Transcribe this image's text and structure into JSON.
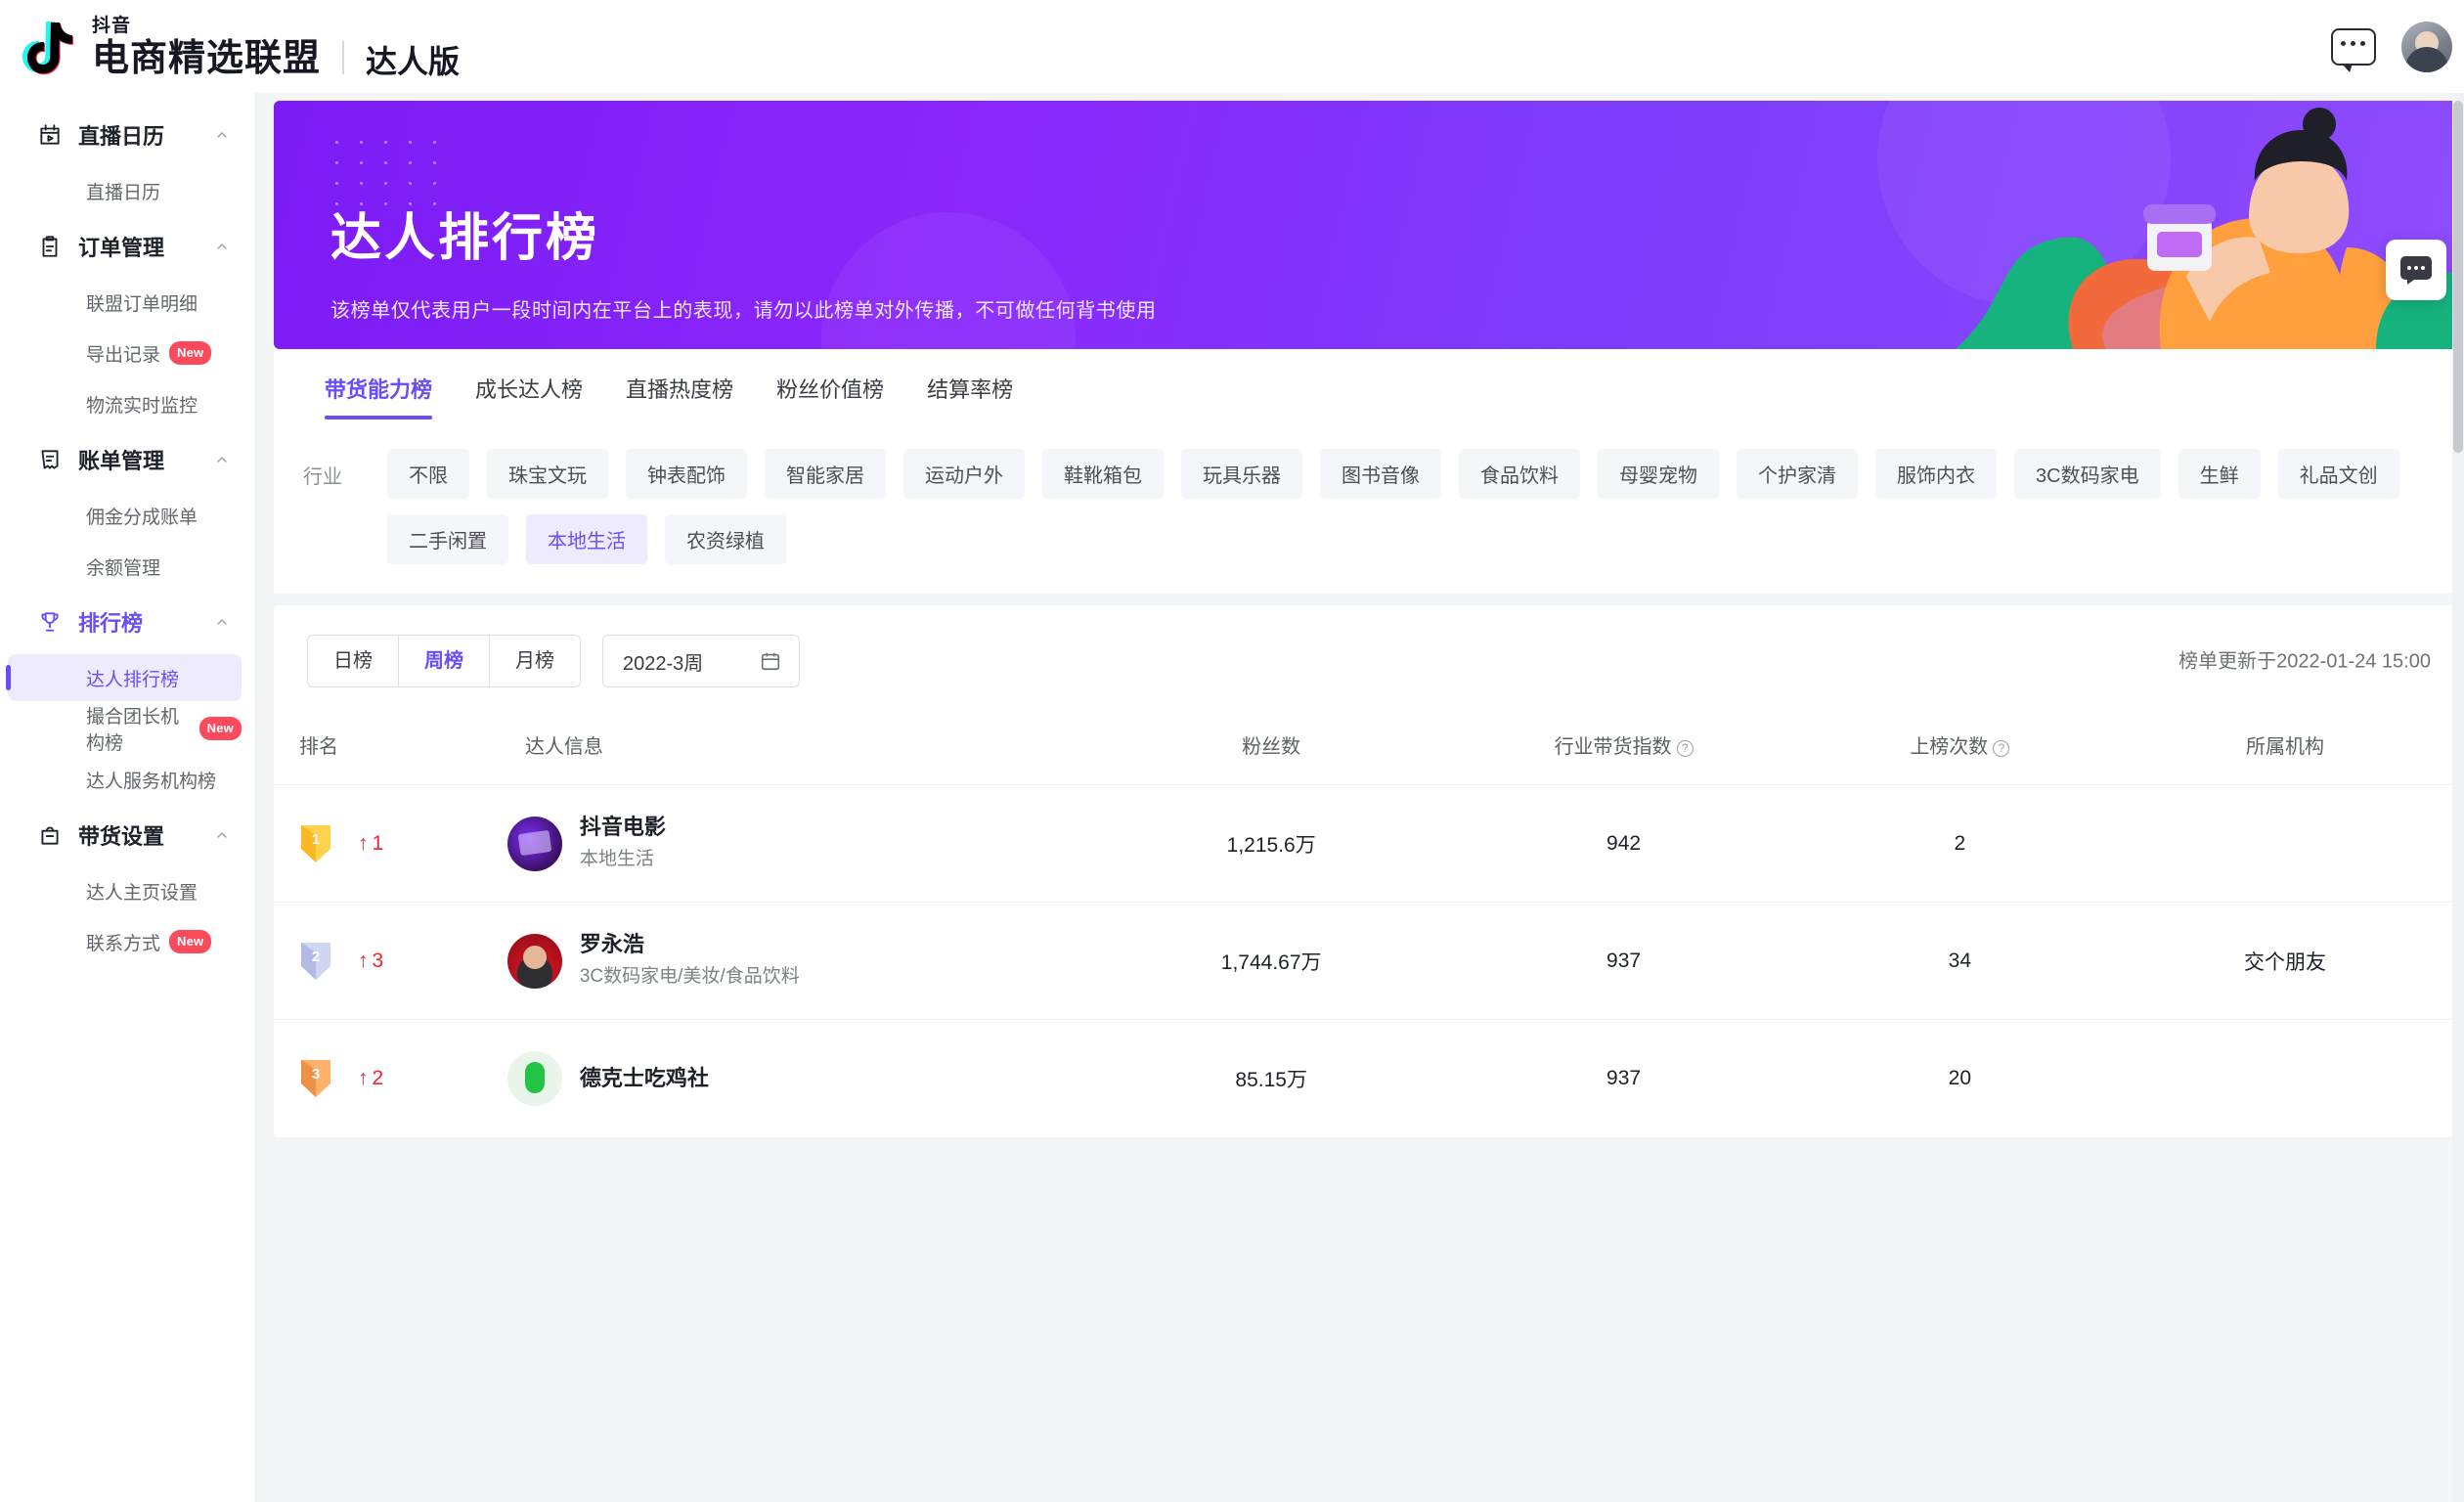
{
  "header": {
    "logo_sup": "抖音",
    "brand_main": "电商精选联盟",
    "brand_sub": "达人版",
    "chat_icon": "chat-bubble-icon",
    "avatar": "user-avatar"
  },
  "sidebar": {
    "groups": [
      {
        "icon": "calendar-play-icon",
        "label": "直播日历",
        "chevron": "chevron-up-icon",
        "active": false,
        "items": [
          {
            "label": "直播日历",
            "badge": "",
            "selected": false
          }
        ]
      },
      {
        "icon": "clipboard-icon",
        "label": "订单管理",
        "chevron": "chevron-up-icon",
        "active": false,
        "items": [
          {
            "label": "联盟订单明细",
            "badge": "",
            "selected": false
          },
          {
            "label": "导出记录",
            "badge": "New",
            "selected": false
          },
          {
            "label": "物流实时监控",
            "badge": "",
            "selected": false
          }
        ]
      },
      {
        "icon": "receipt-icon",
        "label": "账单管理",
        "chevron": "chevron-up-icon",
        "active": false,
        "items": [
          {
            "label": "佣金分成账单",
            "badge": "",
            "selected": false
          },
          {
            "label": "余额管理",
            "badge": "",
            "selected": false
          }
        ]
      },
      {
        "icon": "trophy-icon",
        "label": "排行榜",
        "chevron": "chevron-up-icon",
        "active": true,
        "items": [
          {
            "label": "达人排行榜",
            "badge": "",
            "selected": true
          },
          {
            "label": "撮合团长机构榜",
            "badge": "New",
            "selected": false
          },
          {
            "label": "达人服务机构榜",
            "badge": "",
            "selected": false
          }
        ]
      },
      {
        "icon": "bag-icon",
        "label": "带货设置",
        "chevron": "chevron-up-icon",
        "active": false,
        "items": [
          {
            "label": "达人主页设置",
            "badge": "",
            "selected": false
          },
          {
            "label": "联系方式",
            "badge": "New",
            "selected": false
          }
        ]
      }
    ]
  },
  "banner": {
    "title": "达人排行榜",
    "subtitle": "该榜单仅代表用户一段时间内在平台上的表现，请勿以此榜单对外传播，不可做任何背书使用"
  },
  "tabs": [
    {
      "label": "带货能力榜",
      "active": true
    },
    {
      "label": "成长达人榜",
      "active": false
    },
    {
      "label": "直播热度榜",
      "active": false
    },
    {
      "label": "粉丝价值榜",
      "active": false
    },
    {
      "label": "结算率榜",
      "active": false
    }
  ],
  "filter": {
    "label": "行业",
    "chips": [
      {
        "label": "不限",
        "active": false
      },
      {
        "label": "珠宝文玩",
        "active": false
      },
      {
        "label": "钟表配饰",
        "active": false
      },
      {
        "label": "智能家居",
        "active": false
      },
      {
        "label": "运动户外",
        "active": false
      },
      {
        "label": "鞋靴箱包",
        "active": false
      },
      {
        "label": "玩具乐器",
        "active": false
      },
      {
        "label": "图书音像",
        "active": false
      },
      {
        "label": "食品饮料",
        "active": false
      },
      {
        "label": "母婴宠物",
        "active": false
      },
      {
        "label": "个护家清",
        "active": false
      },
      {
        "label": "服饰内衣",
        "active": false
      },
      {
        "label": "3C数码家电",
        "active": false
      },
      {
        "label": "生鲜",
        "active": false
      },
      {
        "label": "礼品文创",
        "active": false
      },
      {
        "label": "二手闲置",
        "active": false
      },
      {
        "label": "本地生活",
        "active": true
      },
      {
        "label": "农资绿植",
        "active": false
      }
    ]
  },
  "toolbar": {
    "segments": [
      {
        "label": "日榜",
        "active": false
      },
      {
        "label": "周榜",
        "active": true
      },
      {
        "label": "月榜",
        "active": false
      }
    ],
    "date_value": "2022-3周",
    "date_icon": "calendar-icon",
    "update_text": "榜单更新于2022-01-24 15:00"
  },
  "table": {
    "columns": [
      {
        "key": "rank",
        "label": "排名"
      },
      {
        "key": "creator",
        "label": "达人信息"
      },
      {
        "key": "fans",
        "label": "粉丝数"
      },
      {
        "key": "index",
        "label": "行业带货指数",
        "help": true
      },
      {
        "key": "times",
        "label": "上榜次数",
        "help": true
      },
      {
        "key": "org",
        "label": "所属机构"
      }
    ],
    "rows": [
      {
        "rank": "1",
        "medal": "gold",
        "delta_dir": "up",
        "delta": "1",
        "avatar": "douyin-movie-avatar",
        "name": "抖音电影",
        "category": "本地生活",
        "fans": "1,215.6万",
        "index": "942",
        "times": "2",
        "org": ""
      },
      {
        "rank": "2",
        "medal": "silver",
        "delta_dir": "up",
        "delta": "3",
        "avatar": "luoyonghao-avatar",
        "name": "罗永浩",
        "category": "3C数码家电/美妆/食品饮料",
        "fans": "1,744.67万",
        "index": "937",
        "times": "34",
        "org": "交个朋友"
      },
      {
        "rank": "3",
        "medal": "bronze",
        "delta_dir": "up",
        "delta": "2",
        "avatar": "dexter-chicken-avatar",
        "name": "德克士吃鸡社",
        "category": "",
        "fans": "85.15万",
        "index": "937",
        "times": "20",
        "org": ""
      }
    ]
  },
  "float_chat": {
    "icon": "chat-bubble-icon"
  }
}
